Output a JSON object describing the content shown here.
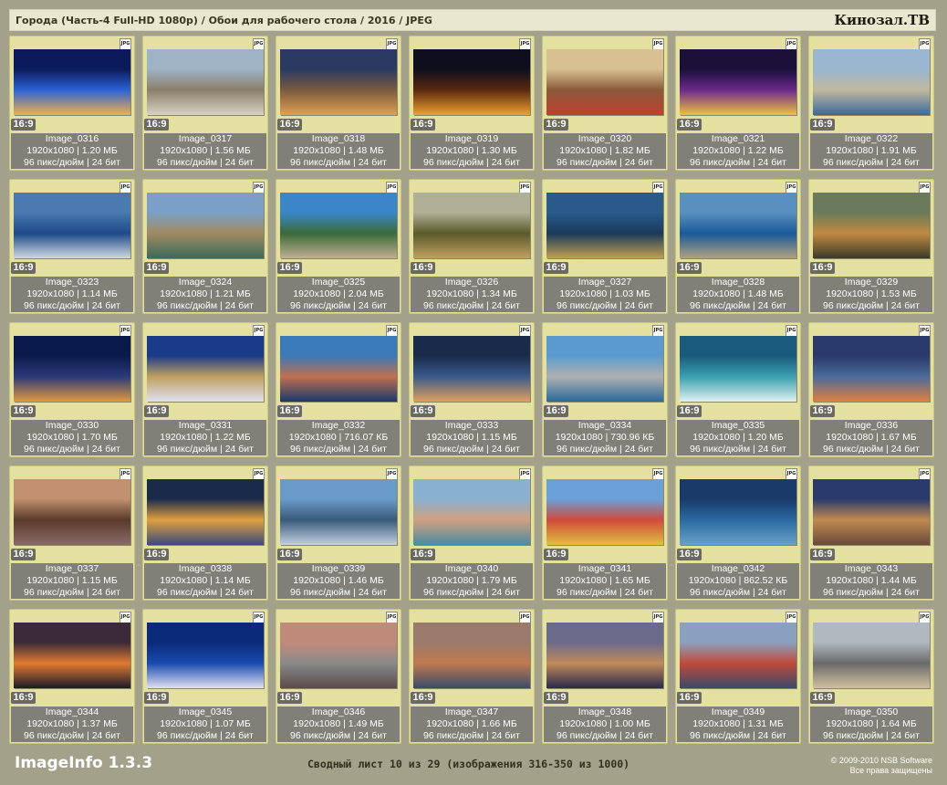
{
  "header": {
    "title": "Города (Часть-4 Full-HD 1080p) / Обои для рабочего стола / 2016 / JPEG",
    "brand": "Кинозал.ТВ"
  },
  "file_badge": "JPG",
  "images": [
    {
      "name": "Image_0316",
      "ratio": "16:9",
      "size": "1920x1080 | 1.20 МБ",
      "meta": "96 пикс/дюйм | 24 бит",
      "palette": [
        "#0a1a5a",
        "#2c63d6",
        "#f0b04a"
      ]
    },
    {
      "name": "Image_0317",
      "ratio": "16:9",
      "size": "1920x1080 | 1.56 МБ",
      "meta": "96 пикс/дюйм | 24 бит",
      "palette": [
        "#9fb3c7",
        "#8a7f6a",
        "#d8d3c4"
      ]
    },
    {
      "name": "Image_0318",
      "ratio": "16:9",
      "size": "1920x1080 | 1.48 МБ",
      "meta": "96 пикс/дюйм | 24 бит",
      "palette": [
        "#2a3a62",
        "#7a5a40",
        "#e0a050"
      ]
    },
    {
      "name": "Image_0319",
      "ratio": "16:9",
      "size": "1920x1080 | 1.30 МБ",
      "meta": "96 пикс/дюйм | 24 бит",
      "palette": [
        "#0e0e1e",
        "#5a2a10",
        "#f0a030"
      ]
    },
    {
      "name": "Image_0320",
      "ratio": "16:9",
      "size": "1920x1080 | 1.82 МБ",
      "meta": "96 пикс/дюйм | 24 бит",
      "palette": [
        "#d8c090",
        "#8a5a3a",
        "#c04030"
      ]
    },
    {
      "name": "Image_0321",
      "ratio": "16:9",
      "size": "1920x1080 | 1.22 МБ",
      "meta": "96 пикс/дюйм | 24 бит",
      "palette": [
        "#1a103a",
        "#6a2a8a",
        "#f0c040"
      ]
    },
    {
      "name": "Image_0322",
      "ratio": "16:9",
      "size": "1920x1080 | 1.91 МБ",
      "meta": "96 пикс/дюйм | 24 бит",
      "palette": [
        "#9ab6d0",
        "#c0b8a0",
        "#3a6a9a"
      ]
    },
    {
      "name": "Image_0323",
      "ratio": "16:9",
      "size": "1920x1080 | 1.14 МБ",
      "meta": "96 пикс/дюйм | 24 бит",
      "palette": [
        "#4a7ab0",
        "#1e4a8a",
        "#d0d8e0"
      ]
    },
    {
      "name": "Image_0324",
      "ratio": "16:9",
      "size": "1920x1080 | 1.21 МБ",
      "meta": "96 пикс/дюйм | 24 бит",
      "palette": [
        "#7aa0c8",
        "#a08a60",
        "#3a6a5a"
      ]
    },
    {
      "name": "Image_0325",
      "ratio": "16:9",
      "size": "1920x1080 | 2.04 МБ",
      "meta": "96 пикс/дюйм | 24 бит",
      "palette": [
        "#3a86c8",
        "#3a6a3a",
        "#c0b090"
      ]
    },
    {
      "name": "Image_0326",
      "ratio": "16:9",
      "size": "1920x1080 | 1.34 МБ",
      "meta": "96 пикс/дюйм | 24 бит",
      "palette": [
        "#b0b098",
        "#5a5a2a",
        "#c0a060"
      ]
    },
    {
      "name": "Image_0327",
      "ratio": "16:9",
      "size": "1920x1080 | 1.03 МБ",
      "meta": "96 пикс/дюйм | 24 бит",
      "palette": [
        "#2a5a8a",
        "#1a3a5a",
        "#c0a050"
      ]
    },
    {
      "name": "Image_0328",
      "ratio": "16:9",
      "size": "1920x1080 | 1.48 МБ",
      "meta": "96 пикс/дюйм | 24 бит",
      "palette": [
        "#5a90c0",
        "#1a5a9a",
        "#b0a080"
      ]
    },
    {
      "name": "Image_0329",
      "ratio": "16:9",
      "size": "1920x1080 | 1.53 МБ",
      "meta": "96 пикс/дюйм | 24 бит",
      "palette": [
        "#6a7a5a",
        "#c08a40",
        "#3a3a2a"
      ]
    },
    {
      "name": "Image_0330",
      "ratio": "16:9",
      "size": "1920x1080 | 1.70 МБ",
      "meta": "96 пикс/дюйм | 24 бит",
      "palette": [
        "#0a1a4a",
        "#2a3a7a",
        "#e09a40"
      ]
    },
    {
      "name": "Image_0331",
      "ratio": "16:9",
      "size": "1920x1080 | 1.22 МБ",
      "meta": "96 пикс/дюйм | 24 бит",
      "palette": [
        "#1a3a8a",
        "#c0a060",
        "#e0e0f0"
      ]
    },
    {
      "name": "Image_0332",
      "ratio": "16:9",
      "size": "1920x1080 | 716.07 КБ",
      "meta": "96 пикс/дюйм | 24 бит",
      "palette": [
        "#3a7ab8",
        "#c07050",
        "#1a3a6a"
      ]
    },
    {
      "name": "Image_0333",
      "ratio": "16:9",
      "size": "1920x1080 | 1.15 МБ",
      "meta": "96 пикс/дюйм | 24 бит",
      "palette": [
        "#1a2a4a",
        "#3a5a8a",
        "#e0a060"
      ]
    },
    {
      "name": "Image_0334",
      "ratio": "16:9",
      "size": "1920x1080 | 730.96 КБ",
      "meta": "96 пикс/дюйм | 24 бит",
      "palette": [
        "#5a9ad0",
        "#b0b0b0",
        "#2a6a9a"
      ]
    },
    {
      "name": "Image_0335",
      "ratio": "16:9",
      "size": "1920x1080 | 1.20 МБ",
      "meta": "96 пикс/дюйм | 24 бит",
      "palette": [
        "#1a5a7a",
        "#3aa0b0",
        "#e0f0f0"
      ]
    },
    {
      "name": "Image_0336",
      "ratio": "16:9",
      "size": "1920x1080 | 1.67 МБ",
      "meta": "96 пикс/дюйм | 24 бит",
      "palette": [
        "#2a3a6a",
        "#4a6a9a",
        "#e08040"
      ]
    },
    {
      "name": "Image_0337",
      "ratio": "16:9",
      "size": "1920x1080 | 1.15 МБ",
      "meta": "96 пикс/дюйм | 24 бит",
      "palette": [
        "#c09070",
        "#5a3a2a",
        "#8a6a6a"
      ]
    },
    {
      "name": "Image_0338",
      "ratio": "16:9",
      "size": "1920x1080 | 1.14 МБ",
      "meta": "96 пикс/дюйм | 24 бит",
      "palette": [
        "#1a2a4a",
        "#e0a040",
        "#3a4a7a"
      ]
    },
    {
      "name": "Image_0339",
      "ratio": "16:9",
      "size": "1920x1080 | 1.46 МБ",
      "meta": "96 пикс/дюйм | 24 бит",
      "palette": [
        "#6a9ac8",
        "#3a5a7a",
        "#c0d0e0"
      ]
    },
    {
      "name": "Image_0340",
      "ratio": "16:9",
      "size": "1920x1080 | 1.79 МБ",
      "meta": "96 пикс/дюйм | 24 бит",
      "palette": [
        "#8ab0d0",
        "#d0a080",
        "#4a8aa0"
      ]
    },
    {
      "name": "Image_0341",
      "ratio": "16:9",
      "size": "1920x1080 | 1.65 МБ",
      "meta": "96 пикс/дюйм | 24 бит",
      "palette": [
        "#6aa0d8",
        "#d04a3a",
        "#e0c040"
      ]
    },
    {
      "name": "Image_0342",
      "ratio": "16:9",
      "size": "1920x1080 | 862.52 КБ",
      "meta": "96 пикс/дюйм | 24 бит",
      "palette": [
        "#1a3a6a",
        "#2a6aa0",
        "#6aa0c8"
      ]
    },
    {
      "name": "Image_0343",
      "ratio": "16:9",
      "size": "1920x1080 | 1.44 МБ",
      "meta": "96 пикс/дюйм | 24 бит",
      "palette": [
        "#2a3a6a",
        "#c08a50",
        "#6a4a3a"
      ]
    },
    {
      "name": "Image_0344",
      "ratio": "16:9",
      "size": "1920x1080 | 1.37 МБ",
      "meta": "96 пикс/дюйм | 24 бит",
      "palette": [
        "#3a2a3a",
        "#e07a30",
        "#1a1a2a"
      ]
    },
    {
      "name": "Image_0345",
      "ratio": "16:9",
      "size": "1920x1080 | 1.07 МБ",
      "meta": "96 пикс/дюйм | 24 бит",
      "palette": [
        "#0a2a7a",
        "#1a4ab0",
        "#e0e0f0"
      ]
    },
    {
      "name": "Image_0346",
      "ratio": "16:9",
      "size": "1920x1080 | 1.49 МБ",
      "meta": "96 пикс/дюйм | 24 бит",
      "palette": [
        "#c08a7a",
        "#8a8a8a",
        "#5a4a4a"
      ]
    },
    {
      "name": "Image_0347",
      "ratio": "16:9",
      "size": "1920x1080 | 1.66 МБ",
      "meta": "96 пикс/дюйм | 24 бит",
      "palette": [
        "#9a7a6a",
        "#c07a50",
        "#3a4a6a"
      ]
    },
    {
      "name": "Image_0348",
      "ratio": "16:9",
      "size": "1920x1080 | 1.00 МБ",
      "meta": "96 пикс/дюйм | 24 бит",
      "palette": [
        "#6a6a8a",
        "#c08a5a",
        "#2a2a4a"
      ]
    },
    {
      "name": "Image_0349",
      "ratio": "16:9",
      "size": "1920x1080 | 1.31 МБ",
      "meta": "96 пикс/дюйм | 24 бит",
      "palette": [
        "#8aa0c0",
        "#c04a3a",
        "#3a4a6a"
      ]
    },
    {
      "name": "Image_0350",
      "ratio": "16:9",
      "size": "1920x1080 | 1.64 МБ",
      "meta": "96 пикс/дюйм | 24 бит",
      "palette": [
        "#b0b8c0",
        "#6a6a6a",
        "#d0c0a0"
      ]
    }
  ],
  "footer": {
    "app_name": "ImageInfo 1.3.3",
    "sheet_info": "Сводный лист 10 из 29 (изображения 316-350 из 1000)",
    "copyright": "© 2009-2010 NSB Software",
    "rights": "Все права защищены"
  }
}
